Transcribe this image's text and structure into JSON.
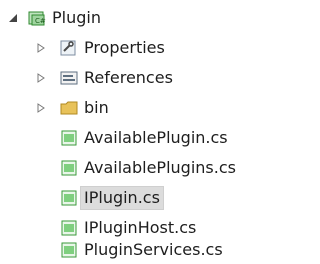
{
  "tree": {
    "project": {
      "label": "Plugin",
      "icon": "csharp-project-icon",
      "expanded": true
    },
    "folders": [
      {
        "label": "Properties",
        "icon": "wrench-properties-icon",
        "expanded": false
      },
      {
        "label": "References",
        "icon": "references-icon",
        "expanded": false
      },
      {
        "label": "bin",
        "icon": "folder-icon",
        "expanded": false
      }
    ],
    "files": [
      {
        "label": "AvailablePlugin.cs",
        "icon": "csharp-file-icon",
        "selected": false
      },
      {
        "label": "AvailablePlugins.cs",
        "icon": "csharp-file-icon",
        "selected": false
      },
      {
        "label": "IPlugin.cs",
        "icon": "csharp-file-icon",
        "selected": true
      },
      {
        "label": "IPluginHost.cs",
        "icon": "csharp-file-icon",
        "selected": false
      },
      {
        "label": "PluginServices.cs",
        "icon": "csharp-file-icon",
        "selected": false
      }
    ]
  },
  "colors": {
    "selection": "#dcdcdc",
    "folder": "#e8c25a",
    "file_green": "#3a9a3a",
    "expander": "#7a7a7a"
  }
}
